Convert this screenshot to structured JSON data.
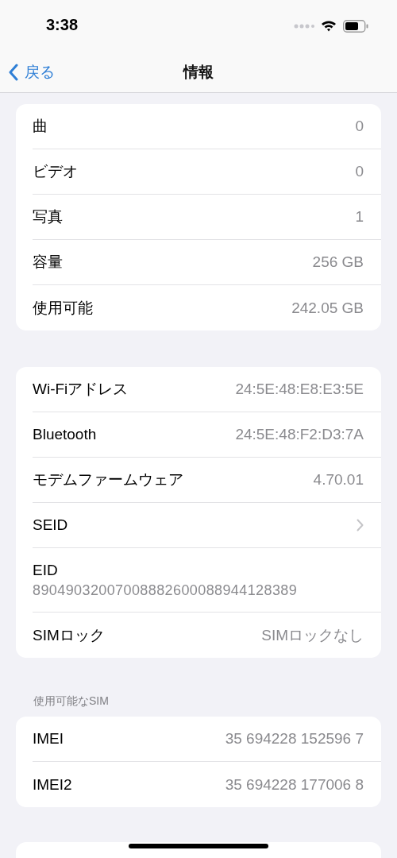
{
  "status_bar": {
    "time": "3:38"
  },
  "nav_bar": {
    "back": "戻る",
    "title": "情報"
  },
  "groups": [
    {
      "rows": [
        {
          "kind": "value",
          "label": "曲",
          "value": "0"
        },
        {
          "kind": "value",
          "label": "ビデオ",
          "value": "0"
        },
        {
          "kind": "value",
          "label": "写真",
          "value": "1"
        },
        {
          "kind": "value",
          "label": "容量",
          "value": "256 GB"
        },
        {
          "kind": "value",
          "label": "使用可能",
          "value": "242.05 GB"
        }
      ]
    },
    {
      "rows": [
        {
          "kind": "value",
          "label": "Wi-Fiアドレス",
          "value": "24:5E:48:E8:E3:5E"
        },
        {
          "kind": "value",
          "label": "Bluetooth",
          "value": "24:5E:48:F2:D3:7A"
        },
        {
          "kind": "value",
          "label": "モデムファームウェア",
          "value": "4.70.01"
        },
        {
          "kind": "link",
          "label": "SEID"
        },
        {
          "kind": "stacked",
          "label": "EID",
          "value": "89049032007008882600088944128389"
        },
        {
          "kind": "value",
          "label": "SIMロック",
          "value": "SIMロックなし"
        }
      ]
    },
    {
      "header": "使用可能なSIM",
      "rows": [
        {
          "kind": "value",
          "label": "IMEI",
          "value": "35 694228 152596 7"
        },
        {
          "kind": "value",
          "label": "IMEI2",
          "value": "35 694228 177006 8"
        }
      ]
    }
  ]
}
